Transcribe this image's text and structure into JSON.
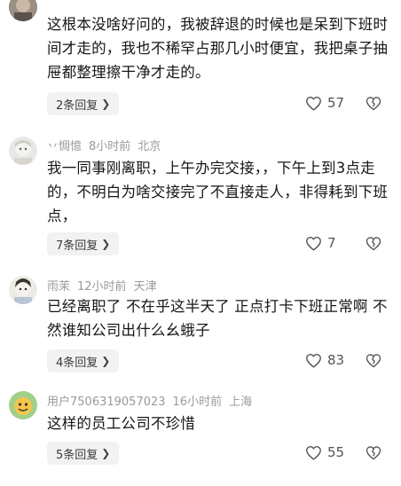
{
  "comments": [
    {
      "username": "",
      "time": "",
      "location": "",
      "text": "这根本没啥好问的，我被辞退的时候也是呆到下班时间才走的，我也不稀罕占那几小时便宜，我把桌子抽屉都整理擦干净才走的。",
      "replies_label": "2条回复",
      "likes": "57"
    },
    {
      "username": "丷惆憶",
      "time": "8小时前",
      "location": "北京",
      "text": "我一同事刚离职，上午办完交接，，下午上到3点走的，不明白为啥交接完了不直接走人，非得耗到下班点，",
      "replies_label": "7条回复",
      "likes": "7"
    },
    {
      "username": "雨茉",
      "time": "12小时前",
      "location": "天津",
      "text": "已经离职了 不在乎这半天了 正点打卡下班正常啊 不然谁知公司出什么幺蛾子",
      "replies_label": "4条回复",
      "likes": "83"
    },
    {
      "username": "用户7506319057023",
      "time": "16小时前",
      "location": "上海",
      "text": "这样的员工公司不珍惜",
      "replies_label": "5条回复",
      "likes": "55"
    }
  ],
  "icons": {
    "like": "heart-outline-icon",
    "dislike": "broken-heart-icon",
    "chevron": "chevron-right-icon"
  },
  "colors": {
    "meta_text": "#9a9a9a",
    "reply_bg": "#f2f2f2"
  }
}
